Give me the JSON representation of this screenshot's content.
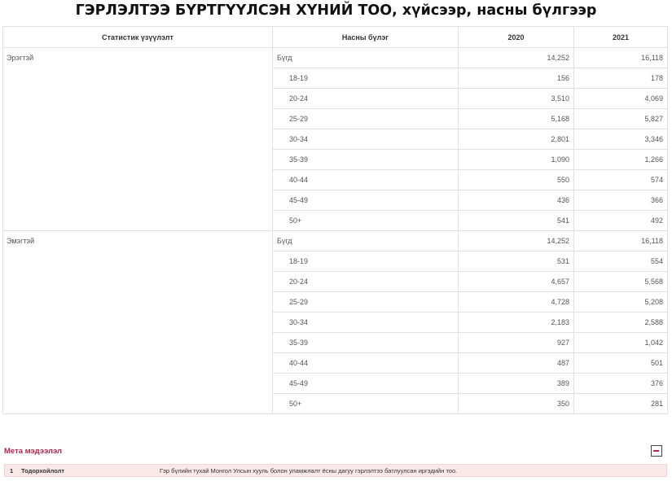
{
  "title": "ГЭРЛЭЛТЭЭ БҮРТГҮҮЛСЭН ХҮНИЙ ТОО, хүйсээр, насны бүлгээр",
  "table": {
    "headers": [
      "Статистик үзүүлэлт",
      "Насны бүлэг",
      "2020",
      "2021"
    ],
    "groups": [
      {
        "indicator": "Эрэгтэй",
        "rows": [
          {
            "age": "Бүгд",
            "y2020": "14,252",
            "y2021": "16,118"
          },
          {
            "age": "18-19",
            "y2020": "156",
            "y2021": "178"
          },
          {
            "age": "20-24",
            "y2020": "3,510",
            "y2021": "4,069"
          },
          {
            "age": "25-29",
            "y2020": "5,168",
            "y2021": "5,827"
          },
          {
            "age": "30-34",
            "y2020": "2,801",
            "y2021": "3,346"
          },
          {
            "age": "35-39",
            "y2020": "1,090",
            "y2021": "1,266"
          },
          {
            "age": "40-44",
            "y2020": "550",
            "y2021": "574"
          },
          {
            "age": "45-49",
            "y2020": "436",
            "y2021": "366"
          },
          {
            "age": "50+",
            "y2020": "541",
            "y2021": "492"
          }
        ]
      },
      {
        "indicator": "Эмэгтэй",
        "rows": [
          {
            "age": "Бүгд",
            "y2020": "14,252",
            "y2021": "16,118"
          },
          {
            "age": "18-19",
            "y2020": "531",
            "y2021": "554"
          },
          {
            "age": "20-24",
            "y2020": "4,657",
            "y2021": "5,568"
          },
          {
            "age": "25-29",
            "y2020": "4,728",
            "y2021": "5,208"
          },
          {
            "age": "30-34",
            "y2020": "2,183",
            "y2021": "2,588"
          },
          {
            "age": "35-39",
            "y2020": "927",
            "y2021": "1,042"
          },
          {
            "age": "40-44",
            "y2020": "487",
            "y2021": "501"
          },
          {
            "age": "45-49",
            "y2020": "389",
            "y2021": "376"
          },
          {
            "age": "50+",
            "y2020": "350",
            "y2021": "281"
          }
        ]
      }
    ]
  },
  "meta": {
    "heading": "Мета мэдээлэл",
    "toggle_icon": "minus-icon",
    "rows": [
      {
        "num": "1",
        "label": "Тодорхойлолт",
        "text": "Гэр бүлийн тухай Монгол Улсын хууль болон уламжлалт ёсны дагуу гэрлэлтээ батлуулсан иргэдийн тоо."
      }
    ]
  },
  "colors": {
    "accent": "#b8264b",
    "meta_bg": "#fbe9e9",
    "border": "#e1e1e1"
  }
}
